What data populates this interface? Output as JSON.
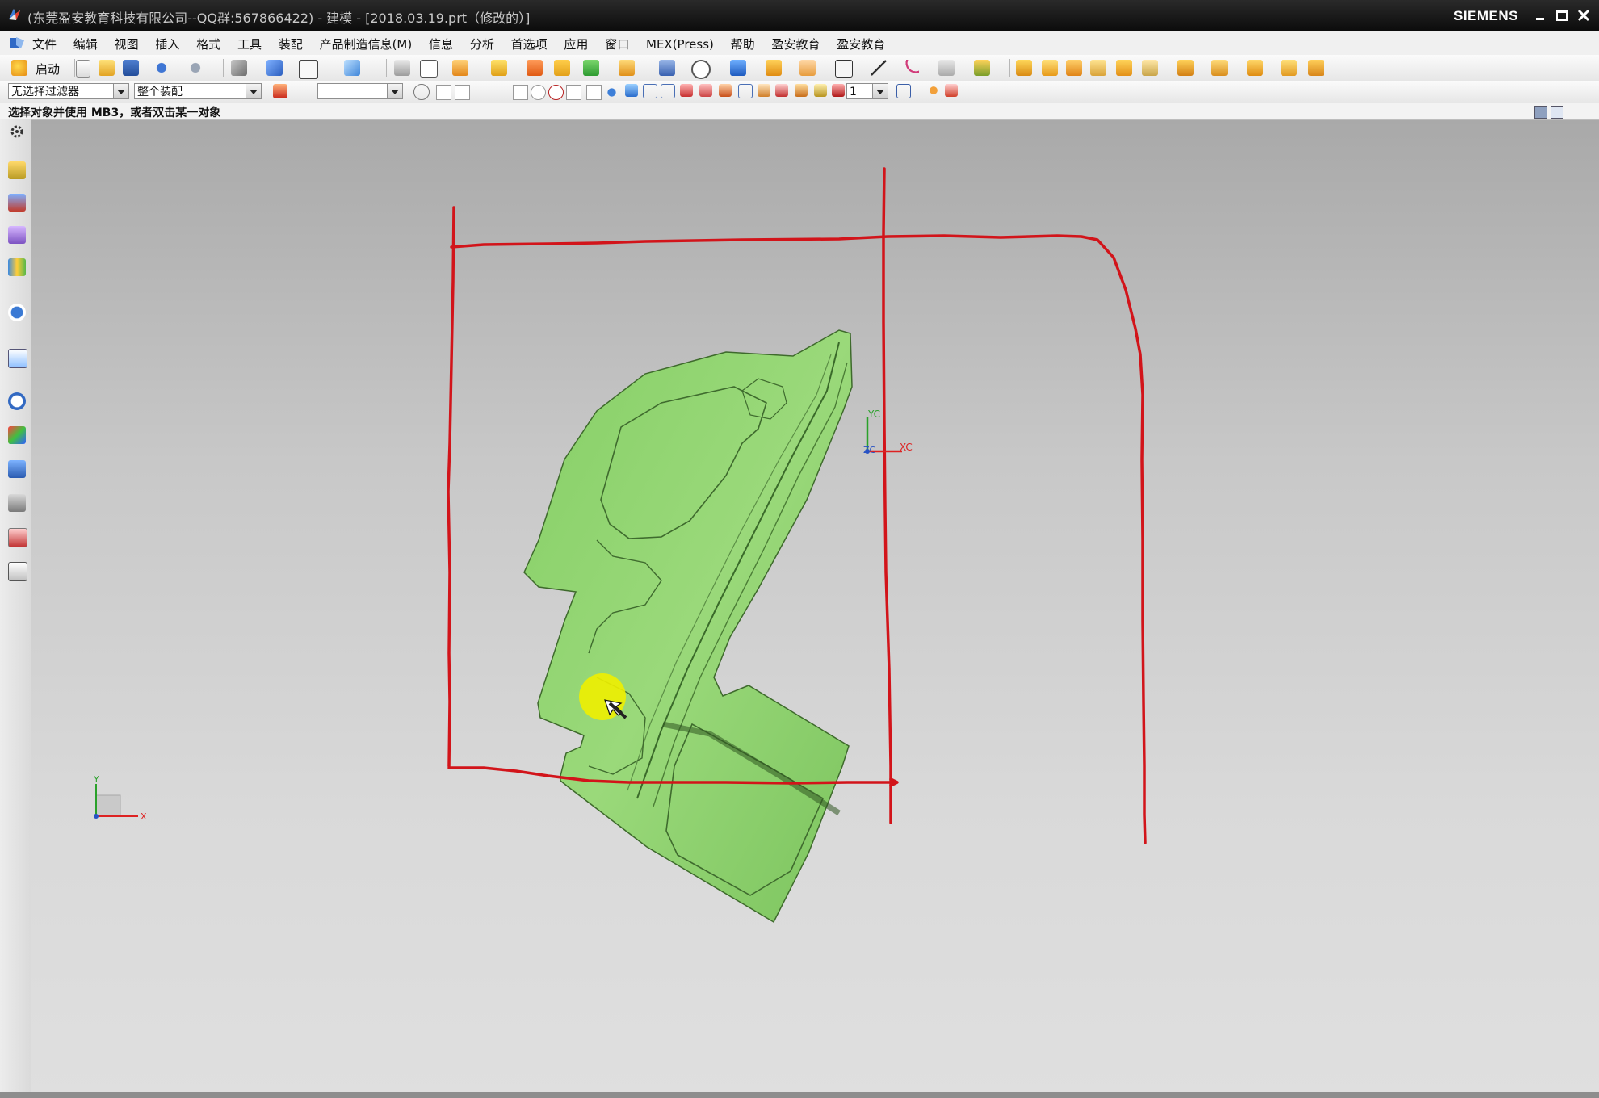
{
  "window": {
    "title": "(东莞盈安教育科技有限公司--QQ群:567866422) - 建模 - [2018.03.19.prt（修改的）]",
    "brand": "SIEMENS",
    "controls": [
      "minimize",
      "maximize",
      "close"
    ]
  },
  "menubar": {
    "items": [
      "文件",
      "编辑",
      "视图",
      "插入",
      "格式",
      "工具",
      "装配",
      "产品制造信息(M)",
      "信息",
      "分析",
      "首选项",
      "应用",
      "窗口",
      "MEX(Press)",
      "帮助",
      "盈安教育",
      "盈安教育"
    ]
  },
  "toolbar": {
    "start_label": "启动"
  },
  "selection_bar": {
    "filter_value": "无选择过滤器",
    "scope_value": "整个装配",
    "layer_value": "1"
  },
  "cue_line": "选择对象并使用 MB3，或者双击某一对象",
  "viewport": {
    "wcs_labels": {
      "y": "YC",
      "x": "XC",
      "z": "ZC"
    },
    "abs_labels": {
      "y": "Y",
      "x": "X"
    },
    "part_color": "#8fd46e",
    "annotation_color": "#d2141a",
    "cursor_highlight_color": "#eef000"
  },
  "colors": {
    "titlebar": "#141414",
    "menubar": "#f0f0f0"
  },
  "icons": {
    "title_app": "nx-app-icon",
    "resource_bar": [
      "gear-icon",
      "assembly-navigator-icon",
      "constraint-navigator-icon",
      "part-navigator-icon",
      "reuse-library-icon",
      "hd3d-icon",
      "web-browser-icon",
      "history-icon",
      "system-materials-icon",
      "process-studio-icon",
      "manufacturing-wizard-icon",
      "roles-icon",
      "system-scenes-icon"
    ]
  }
}
